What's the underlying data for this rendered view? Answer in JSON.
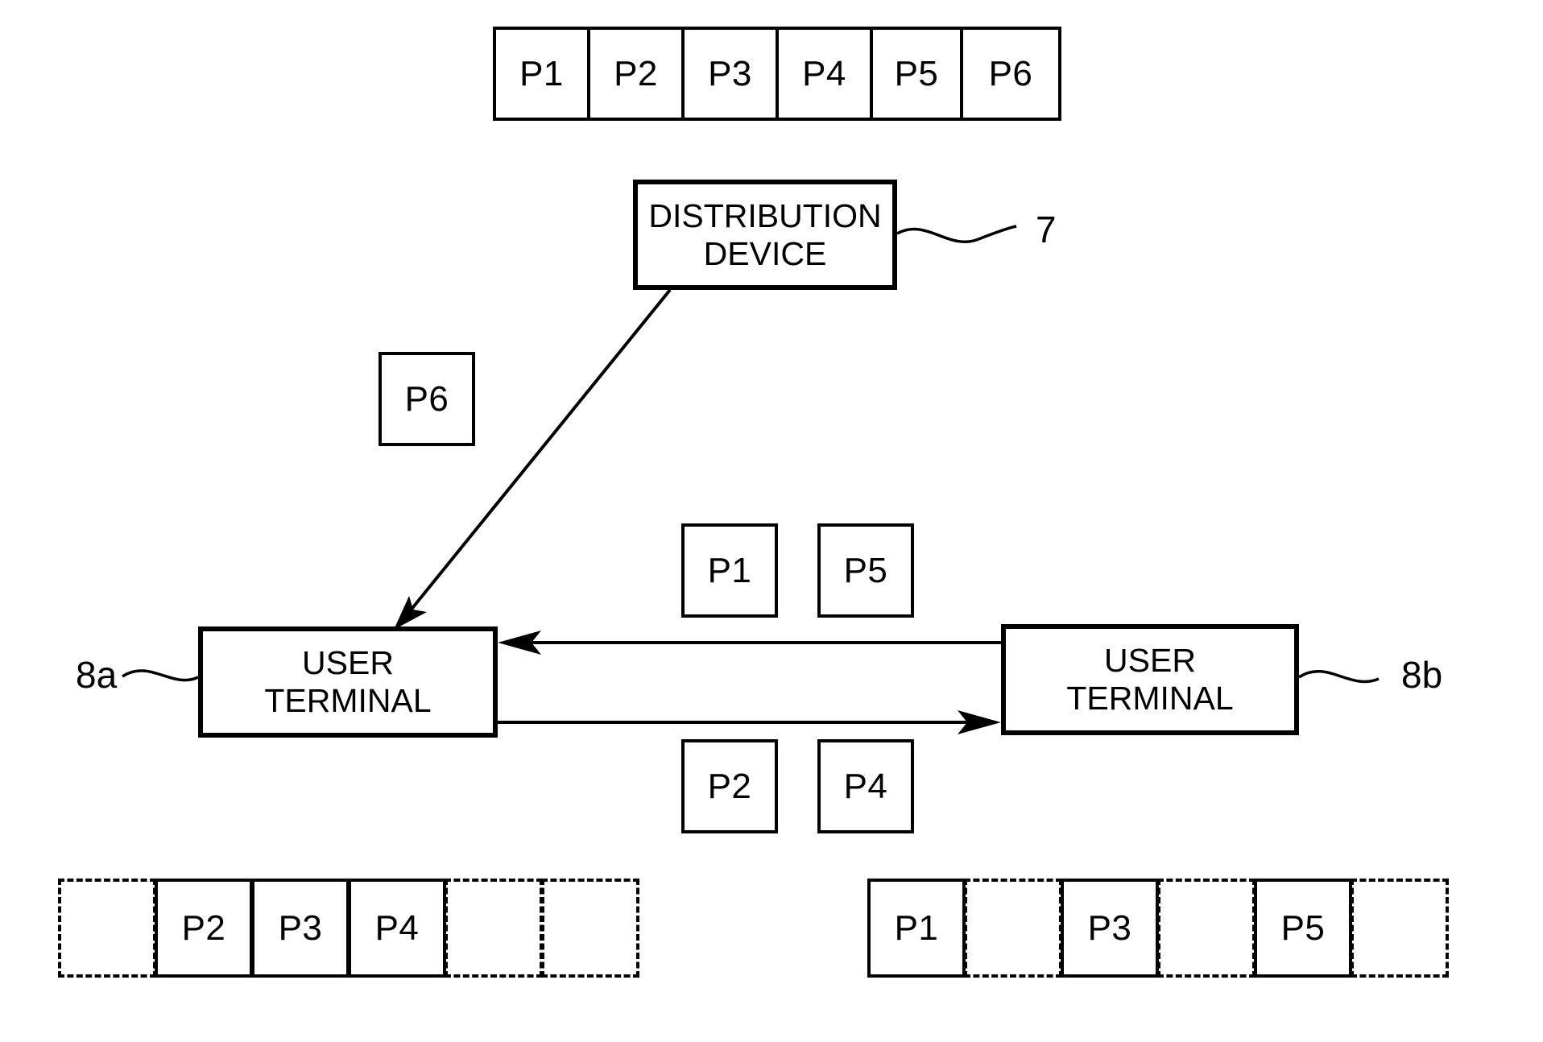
{
  "figure": {
    "type": "patent-diagram",
    "description": "Packet distribution between a distribution device and two user terminals"
  },
  "source_stream": {
    "name": "source-packet-stream",
    "cells": [
      {
        "label": "P1"
      },
      {
        "label": "P2"
      },
      {
        "label": "P3"
      },
      {
        "label": "P4"
      },
      {
        "label": "P5"
      },
      {
        "label": "P6"
      }
    ]
  },
  "distribution_device": {
    "title_line1": "DISTRIBUTION",
    "title_line2": "DEVICE",
    "ref": "7"
  },
  "in_flight": {
    "to_terminal_a": {
      "label": "P6"
    },
    "from_b_to_a": [
      {
        "label": "P1"
      },
      {
        "label": "P5"
      }
    ],
    "from_a_to_b": [
      {
        "label": "P2"
      },
      {
        "label": "P4"
      }
    ]
  },
  "terminal_a": {
    "title_line1": "USER",
    "title_line2": "TERMINAL",
    "ref": "8a"
  },
  "terminal_b": {
    "title_line1": "USER",
    "title_line2": "TERMINAL",
    "ref": "8b"
  },
  "buffer_a": {
    "name": "terminal-a-buffer",
    "cells": [
      {
        "label": "",
        "filled": false
      },
      {
        "label": "P2",
        "filled": true
      },
      {
        "label": "P3",
        "filled": true
      },
      {
        "label": "P4",
        "filled": true
      },
      {
        "label": "",
        "filled": false
      },
      {
        "label": "",
        "filled": false
      }
    ]
  },
  "buffer_b": {
    "name": "terminal-b-buffer",
    "cells": [
      {
        "label": "P1",
        "filled": true
      },
      {
        "label": "",
        "filled": false
      },
      {
        "label": "P3",
        "filled": true
      },
      {
        "label": "",
        "filled": false
      },
      {
        "label": "P5",
        "filled": true
      },
      {
        "label": "",
        "filled": false
      }
    ]
  },
  "colors": {
    "ink": "#000000",
    "paper": "#ffffff"
  }
}
